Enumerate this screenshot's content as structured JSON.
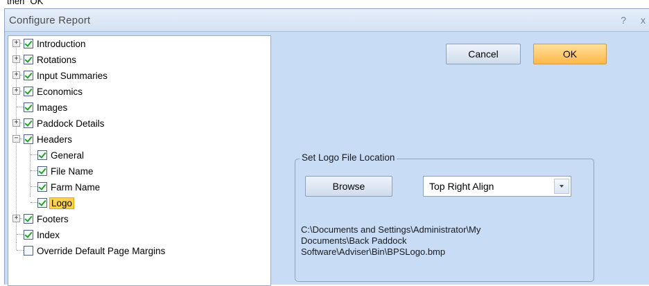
{
  "top_fragment": "then \"OK\"",
  "window": {
    "title": "Configure Report",
    "help_symbol": "?",
    "close_symbol": "x"
  },
  "tree": [
    {
      "label": "Introduction",
      "checked": true
    },
    {
      "label": "Rotations",
      "checked": true
    },
    {
      "label": "Input Summaries",
      "checked": true
    },
    {
      "label": "Economics",
      "checked": true
    },
    {
      "label": "Images",
      "checked": true
    },
    {
      "label": "Paddock Details",
      "checked": true
    },
    {
      "label": "Headers",
      "checked": true
    },
    {
      "label": "General",
      "checked": true
    },
    {
      "label": "File Name",
      "checked": true
    },
    {
      "label": "Farm Name",
      "checked": true
    },
    {
      "label": "Logo",
      "checked": true,
      "selected": true
    },
    {
      "label": "Footers",
      "checked": true
    },
    {
      "label": "Index",
      "checked": true
    },
    {
      "label": "Override Default Page Margins",
      "checked": false
    }
  ],
  "buttons": {
    "cancel": "Cancel",
    "ok": "OK",
    "browse": "Browse"
  },
  "logo_group": {
    "legend": "Set Logo File Location",
    "align_value": "Top Right Align",
    "path_lines": [
      "C:\\Documents and Settings\\Administrator\\My",
      "Documents\\Back Paddock",
      "Software\\Adviser\\Bin\\BPSLogo.bmp"
    ]
  }
}
